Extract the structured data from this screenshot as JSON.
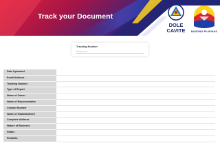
{
  "header": {
    "title": "Track your Document",
    "dole_logo": {
      "icon": "dole-seal-icon",
      "line1": "DOLE",
      "line2": "CAVITE"
    },
    "bagong_pilipinas_logo": {
      "icon": "bagong-pilipinas-seal-icon",
      "label": "BAGONG PILIPINAS"
    }
  },
  "tracking": {
    "label": "Tracking Number",
    "input_value": "",
    "placeholder": "Reference"
  },
  "details": {
    "fields": [
      {
        "label": "Date Uploaded",
        "value": ""
      },
      {
        "label": "Email Address",
        "value": ""
      },
      {
        "label": "Tracking Number",
        "value": ""
      },
      {
        "label": "Type of Report",
        "value": ""
      },
      {
        "label": "Name of Owner",
        "value": ""
      },
      {
        "label": "Name of Representative",
        "value": ""
      },
      {
        "label": "Contact Number",
        "value": ""
      },
      {
        "label": "Name of Establishment",
        "value": ""
      },
      {
        "label": "Complete Address",
        "value": ""
      },
      {
        "label": "Nature of Business",
        "value": ""
      },
      {
        "label": "Status",
        "value": ""
      },
      {
        "label": "Remarks",
        "value": ""
      }
    ]
  },
  "colors": {
    "banner_red": "#c8102e",
    "banner_blue": "#1f2e8c",
    "label_background": "#d7d7d7"
  }
}
